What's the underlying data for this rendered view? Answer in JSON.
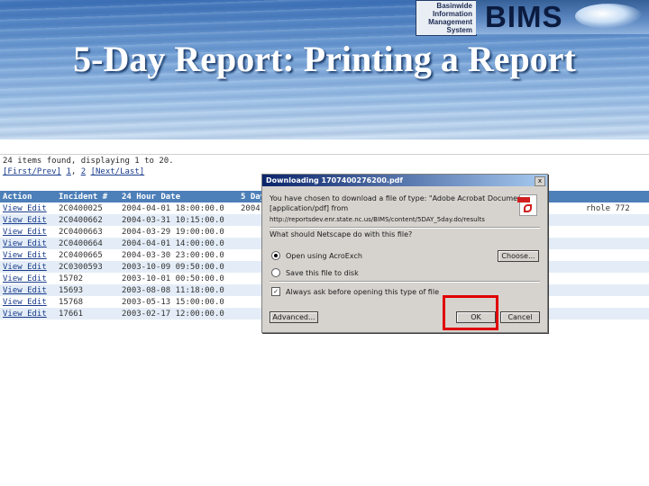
{
  "slide": {
    "title": "5-Day Report:  Printing a Report",
    "logo": {
      "lines": [
        "Basinwide",
        "Information",
        "Management",
        "System"
      ],
      "brand": "BIMS"
    }
  },
  "app": {
    "status_text": "24 items found, displaying 1 to 20.",
    "pager": {
      "first_prev": "[First/Prev]",
      "page1": "1",
      "page2": "2",
      "next_last": "[Next/Last]"
    },
    "columns": [
      "Action",
      "Incident #",
      "24 Hour Date",
      "5 Day"
    ],
    "extra_fragment": "rhole 772",
    "rows": [
      {
        "action": "View Edit",
        "incident": "2C0400025",
        "date": "2004-04-01 18:00:00.0",
        "day5": "2004-"
      },
      {
        "action": "View Edit",
        "incident": "2C0400662",
        "date": "2004-03-31 10:15:00.0",
        "day5": ""
      },
      {
        "action": "View Edit",
        "incident": "2C0400663",
        "date": "2004-03-29 19:00:00.0",
        "day5": ""
      },
      {
        "action": "View Edit",
        "incident": "2C0400664",
        "date": "2004-04-01 14:00:00.0",
        "day5": ""
      },
      {
        "action": "View Edit",
        "incident": "2C0400665",
        "date": "2004-03-30 23:00:00.0",
        "day5": ""
      },
      {
        "action": "View Edit",
        "incident": "2C0300593",
        "date": "2003-10-09 09:50:00.0",
        "day5": ""
      },
      {
        "action": "View Edit",
        "incident": "15702",
        "date": "2003-10-01 00:50:00.0",
        "day5": ""
      },
      {
        "action": "View Edit",
        "incident": "15693",
        "date": "2003-08-08 11:18:00.0",
        "day5": ""
      },
      {
        "action": "View Edit",
        "incident": "15768",
        "date": "2003-05-13 15:00:00.0",
        "day5": ""
      },
      {
        "action": "View Edit",
        "incident": "17661",
        "date": "2003-02-17 12:00:00.0",
        "day5": ""
      }
    ]
  },
  "dialog": {
    "title": "Downloading 1707400276200.pdf",
    "line1": "You have chosen to download a file of type: \"Adobe Acrobat Document\"",
    "line2": "[application/pdf] from",
    "line3": "http://reportsdev.enr.state.nc.us/BIMS/content/5DAY_5day.do/results",
    "question": "What should Netscape do with this file?",
    "option_open": "Open using AcroExch",
    "choose_label": "Choose...",
    "option_save": "Save this file to disk",
    "option_always": "Always ask before opening this type of file",
    "advanced_label": "Advanced...",
    "ok_label": "OK",
    "cancel_label": "Cancel",
    "close_glyph": "x"
  }
}
